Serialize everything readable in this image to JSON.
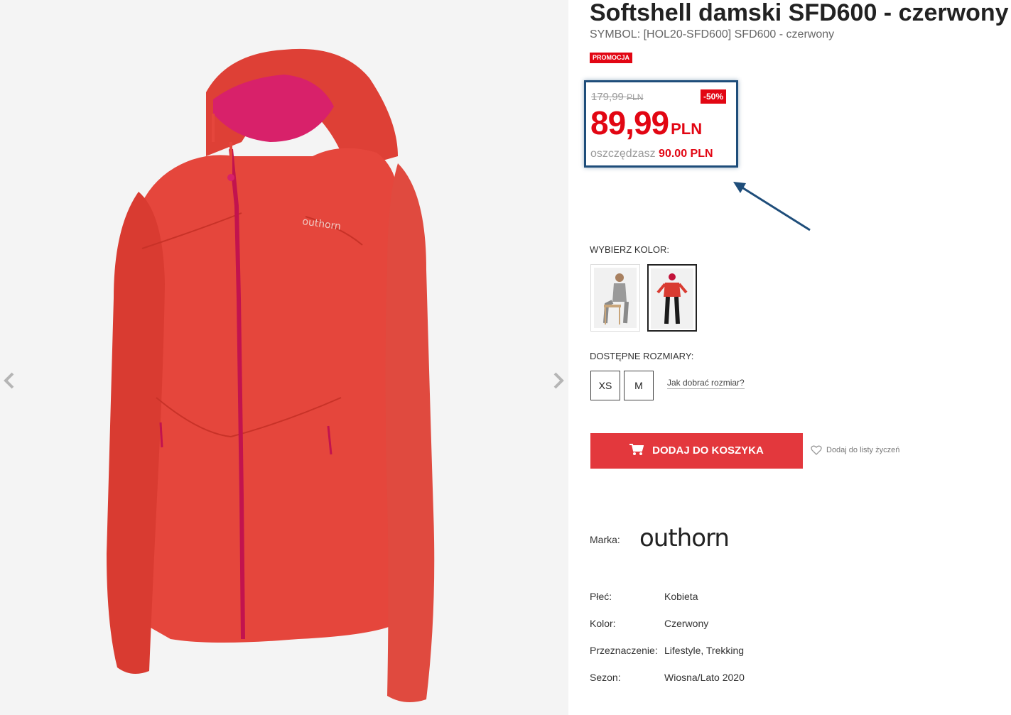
{
  "product": {
    "title": "Softshell damski SFD600 - czerwony",
    "symbol": "SYMBOL: [HOL20-SFD600] SFD600 - czerwony",
    "promo_badge": "PROMOCJA"
  },
  "price": {
    "old_amount": "179,99",
    "old_currency": "PLN",
    "discount": "-50%",
    "new_amount": "89,99",
    "new_currency": "PLN",
    "savings_label": "oszczędzasz",
    "savings_value": "90.00 PLN"
  },
  "colors": {
    "label": "WYBIERZ KOLOR:",
    "options": [
      {
        "name": "gray",
        "selected": false
      },
      {
        "name": "red",
        "selected": true
      }
    ]
  },
  "sizes": {
    "label": "DOSTĘPNE ROZMIARY:",
    "options": [
      "XS",
      "M"
    ],
    "guide_link": "Jak dobrać rozmiar?"
  },
  "actions": {
    "add_to_cart": "DODAJ DO KOSZYKA",
    "wishlist": "Dodaj do listy życzeń"
  },
  "brand": {
    "label": "Marka:",
    "name": "outhorn"
  },
  "attributes": [
    {
      "key": "Płeć:",
      "value": "Kobieta"
    },
    {
      "key": "Kolor:",
      "value": "Czerwony"
    },
    {
      "key": "Przeznaczenie:",
      "value": "Lifestyle, Trekking"
    },
    {
      "key": "Sezon:",
      "value": "Wiosna/Lato 2020"
    }
  ],
  "gallery": {
    "jacket_logo": "outhorn"
  },
  "colors_theme": {
    "accent_red": "#e20613",
    "button_red": "#e3383d",
    "callout_blue": "#1e4d7a",
    "jacket": "#e5463c"
  },
  "icons": [
    "chevron-left-icon",
    "chevron-right-icon",
    "cart-icon",
    "heart-icon",
    "callout-arrow"
  ]
}
